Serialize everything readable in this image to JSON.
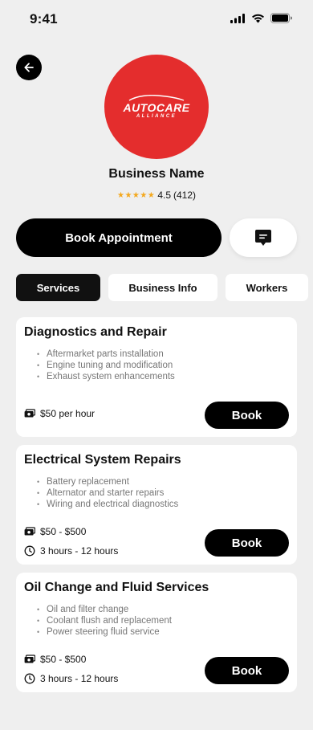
{
  "status_bar": {
    "time": "9:41"
  },
  "business": {
    "logo_main": "AUTOCARE",
    "logo_sub": "ALLIANCE",
    "name": "Business Name",
    "stars": "★★★★★",
    "rating": "4.5",
    "reviews": "(412)"
  },
  "actions": {
    "book_appointment": "Book Appointment"
  },
  "tabs": [
    {
      "label": "Services",
      "active": true
    },
    {
      "label": "Business Info",
      "active": false
    },
    {
      "label": "Workers",
      "active": false
    }
  ],
  "services": [
    {
      "title": "Diagnostics and Repair",
      "items": [
        "Aftermarket parts installation",
        "Engine tuning and modification",
        "Exhaust system enhancements"
      ],
      "price": "$50 per hour",
      "duration": "",
      "book_label": "Book"
    },
    {
      "title": "Electrical System Repairs",
      "items": [
        "Battery replacement",
        "Alternator and starter repairs",
        "Wiring and electrical diagnostics"
      ],
      "price": "$50 - $500",
      "duration": "3 hours - 12 hours",
      "book_label": "Book"
    },
    {
      "title": "Oil Change and Fluid Services",
      "items": [
        "Oil and filter change",
        "Coolant flush and replacement",
        "Power steering fluid service"
      ],
      "price": "$50 - $500",
      "duration": "3 hours - 12 hours",
      "book_label": "Book"
    }
  ],
  "colors": {
    "brand": "#e42d2d",
    "star": "#f4a81d",
    "primary": "#000000",
    "background": "#efefef"
  }
}
